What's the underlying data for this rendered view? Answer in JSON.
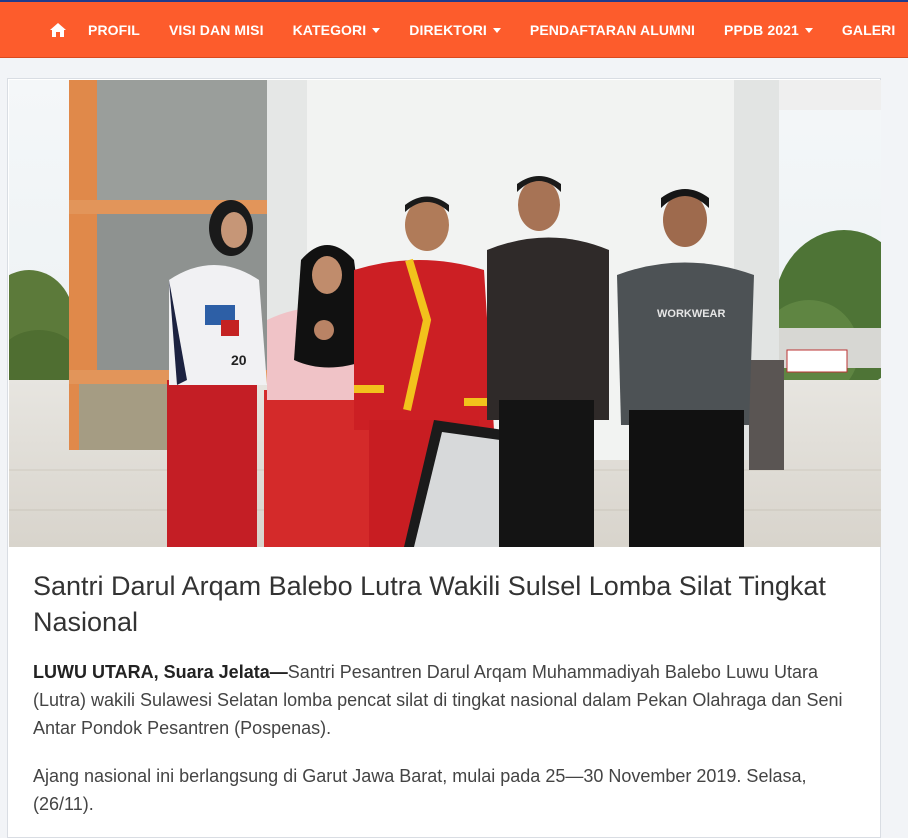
{
  "nav": {
    "home_icon": "home-icon",
    "items": [
      {
        "label": "PROFIL",
        "dropdown": false
      },
      {
        "label": "VISI DAN MISI",
        "dropdown": false
      },
      {
        "label": "KATEGORI",
        "dropdown": true
      },
      {
        "label": "DIREKTORI",
        "dropdown": true
      },
      {
        "label": "PENDAFTARAN ALUMNI",
        "dropdown": false
      },
      {
        "label": "PPDB 2021",
        "dropdown": true
      },
      {
        "label": "GALERI",
        "dropdown": false
      }
    ],
    "colors": {
      "bar": "#fd5c2c",
      "top_border": "#1f3b8c",
      "text": "#ffffff"
    }
  },
  "article": {
    "image_subject": "five people standing under a building canopy, two in red pencak silat uniforms",
    "title": "Santri Darul Arqam Balebo Lutra Wakili Sulsel Lomba Silat Tingkat Nasional",
    "paragraphs": [
      {
        "lead": "LUWU UTARA, Suara Jelata—",
        "text": "Santri Pesantren Darul Arqam Muhammadiyah Balebo Luwu Utara (Lutra) wakili Sulawesi Selatan lomba pencat silat di tingkat nasional dalam Pekan Olahraga dan Seni Antar Pondok Pesantren (Pospenas)."
      },
      {
        "lead": "",
        "text": "Ajang nasional ini berlangsung di Garut Jawa Barat, mulai pada 25—30 November 2019. Selasa, (26/11)."
      }
    ]
  }
}
